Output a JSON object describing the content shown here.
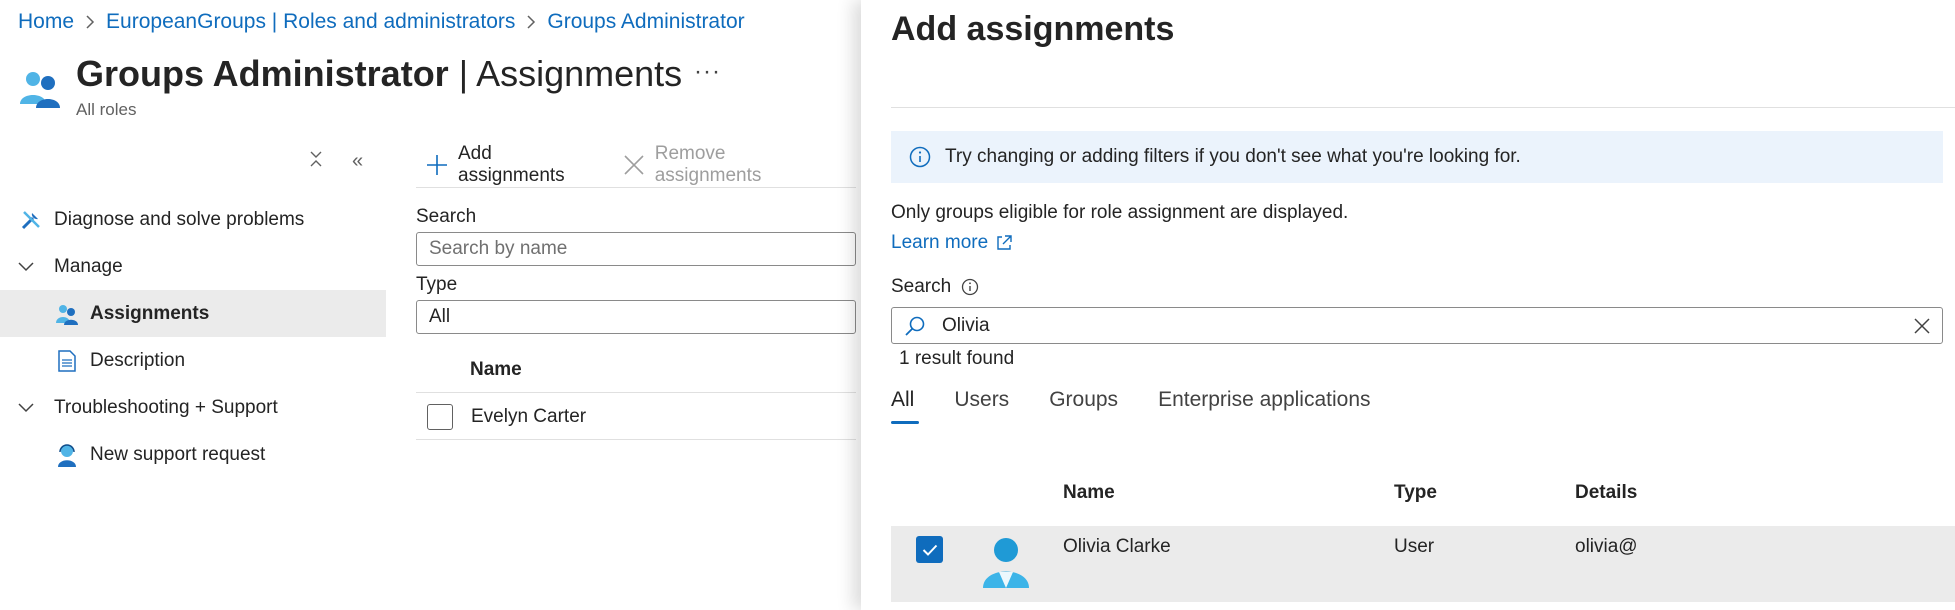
{
  "breadcrumb": [
    "Home",
    "EuropeanGroups | Roles and administrators",
    "Groups Administrator"
  ],
  "header": {
    "title_bold": "Groups Administrator",
    "title_sep": " | ",
    "title_light": "Assignments",
    "subtitle": "All roles",
    "more": "···"
  },
  "nav": {
    "collapse_glyph": "«",
    "diagnose": "Diagnose and solve problems",
    "manage": "Manage",
    "assignments": "Assignments",
    "description": "Description",
    "troubleshooting": "Troubleshooting + Support",
    "support": "New support request"
  },
  "toolbar": {
    "add": "Add assignments",
    "remove": "Remove assignments"
  },
  "filters": {
    "search_label": "Search",
    "search_placeholder": "Search by name",
    "type_label": "Type",
    "type_value": "All"
  },
  "list": {
    "header_name": "Name",
    "rows": [
      "Evelyn Carter"
    ]
  },
  "panel": {
    "title": "Add assignments",
    "info": "Try changing or adding filters if you don't see what you're looking for.",
    "eligible": "Only groups eligible for role assignment are displayed.",
    "learn_more": "Learn more",
    "search_label": "Search",
    "search_value": "Olivia",
    "result_count": "1 result found",
    "tabs": [
      "All",
      "Users",
      "Groups",
      "Enterprise applications"
    ],
    "columns": {
      "name": "Name",
      "type": "Type",
      "details": "Details"
    },
    "results": [
      {
        "name": "Olivia Clarke",
        "type": "User",
        "details": "olivia@",
        "checked": true
      }
    ]
  },
  "colors": {
    "accent": "#0f6cbd",
    "selected_bg": "#ebebeb",
    "info_bg": "#ebf3fc"
  }
}
